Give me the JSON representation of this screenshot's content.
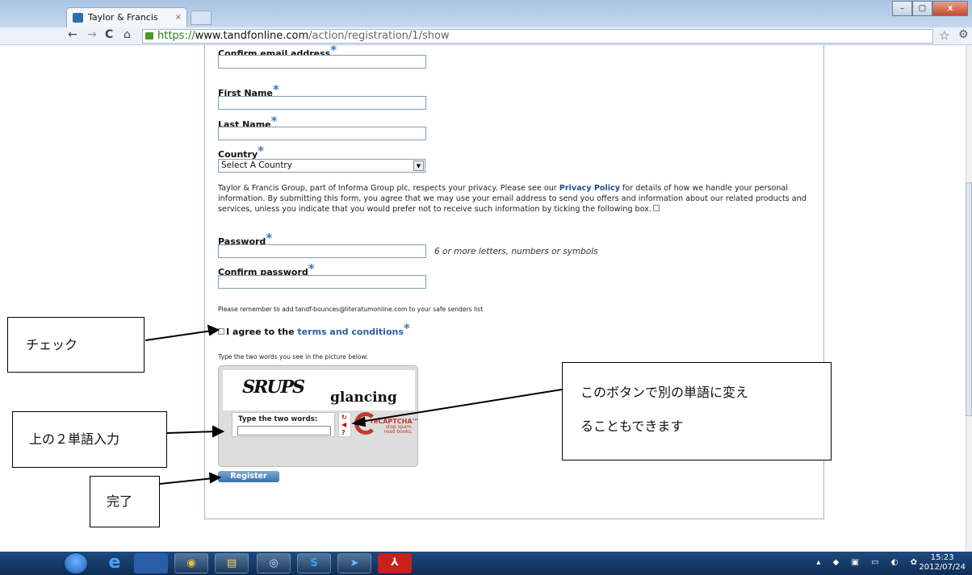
{
  "browser": {
    "tab_title": "Taylor & Francis Online",
    "tab_close": "×",
    "url_https": "https://",
    "url_host": "www.tandfonline.com",
    "url_path": "/action/registration/1/show",
    "window_controls": [
      "–",
      "▢",
      "x"
    ]
  },
  "form": {
    "confirm_email_label": "Confirm email address",
    "first_name_label": "First Name",
    "last_name_label": "Last Name",
    "country_label": "Country",
    "country_selected": "Select A Country",
    "required_mark": "*",
    "privacy_text_1": "Taylor & Francis Group, part of Informa Group plc, respects your privacy. Please see our ",
    "privacy_link": "Privacy Policy",
    "privacy_text_2": " for details of how we handle your personal information. By submitting this form, you agree that we may use your email address to send you offers and information about our related products and services, unless you indicate that you would prefer not to receive such information by ticking the following box.",
    "password_label": "Password",
    "password_hint": "6 or more letters, numbers or symbols",
    "confirm_password_label": "Confirm password",
    "safe_senders_note": "Please remember to add tandf-bounces@literatumonline.com to your safe senders list",
    "agree_text": "I agree to the ",
    "terms_link": "terms and conditions",
    "captcha_prompt": "Type the two words you see in the picture below:",
    "register_label": "Register"
  },
  "captcha": {
    "word1": "SRUPS",
    "word2": "glancing",
    "input_label": "Type the two words:",
    "brand": "reCAPTCHA™",
    "tagline_1": "stop spam.",
    "tagline_2": "read books."
  },
  "annotations": {
    "check": "チェック",
    "reload_hint_1": "このボタンで別の単語に変え",
    "reload_hint_2": "ることもできます",
    "enter_words": "上の２単語入力",
    "done": "完了"
  },
  "taskbar": {
    "time": "15:23",
    "date": "2012/07/24"
  },
  "colors": {
    "link": "#2a5ea8",
    "required": "#3a78c2",
    "button": "#3b6fa8"
  }
}
